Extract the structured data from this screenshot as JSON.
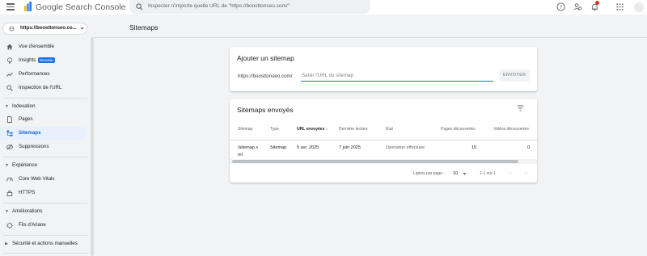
{
  "app": {
    "brand": "Google Search Console",
    "search_placeholder": "Inspecter n'importe quelle URL de \"https://boosttonseo.com/\""
  },
  "header": {
    "notification_indicator": true
  },
  "sidebar": {
    "property": "https://boosttonseo.co...",
    "items": [
      {
        "label": "Vue d'ensemble",
        "icon": "home-icon"
      },
      {
        "label": "Insights",
        "icon": "insights-icon",
        "badge": "Nouveau"
      },
      {
        "label": "Performances",
        "icon": "trending-up-icon"
      },
      {
        "label": "Inspection de l'URL",
        "icon": "search-icon"
      }
    ],
    "sections": [
      {
        "label": "Indexation",
        "items": [
          {
            "label": "Pages",
            "icon": "pages-icon"
          },
          {
            "label": "Sitemaps",
            "icon": "sitemap-icon",
            "active": true
          },
          {
            "label": "Suppressions",
            "icon": "removals-icon"
          }
        ]
      },
      {
        "label": "Expérience",
        "items": [
          {
            "label": "Core Web Vitals",
            "icon": "speed-icon"
          },
          {
            "label": "HTTPS",
            "icon": "lock-icon"
          }
        ]
      },
      {
        "label": "Améliorations",
        "items": [
          {
            "label": "Fils d'Ariane",
            "icon": "breadcrumb-icon"
          }
        ]
      },
      {
        "label": "Sécurité et actions manuelles",
        "items": []
      }
    ]
  },
  "main": {
    "page_title": "Sitemaps",
    "add_card": {
      "title": "Ajouter un sitemap",
      "prefix": "https://boosttonseo.com/",
      "input_placeholder": "Saisir l'URL du sitemap",
      "button": "ENVOYER"
    },
    "submitted_card": {
      "title": "Sitemaps envoyés",
      "columns": [
        "Sitemap",
        "Type",
        "URL envoyées",
        "Dernière lecture",
        "État",
        "Pages découvertes",
        "Vidéos découvertes"
      ],
      "sort_indicator": "↓",
      "rows": [
        {
          "sitemap_line1": "/sitemap.x",
          "sitemap_line2": "ml",
          "type": "Sitemap",
          "submitted": "5 avr. 2025",
          "last_read": "7 juin 2025",
          "status": "Opération effectuée",
          "pages": "15",
          "videos": "0"
        }
      ],
      "pagination": {
        "rows_per_page_label": "Lignes par page :",
        "rows_per_page": "10",
        "range": "1-1 sur 1",
        "prev": "‹",
        "next": "›"
      }
    }
  },
  "colors": {
    "accent": "#1a73e8",
    "active_bg": "#e8f0fe",
    "badge": "#1a73e8",
    "notification": "#d93025"
  }
}
